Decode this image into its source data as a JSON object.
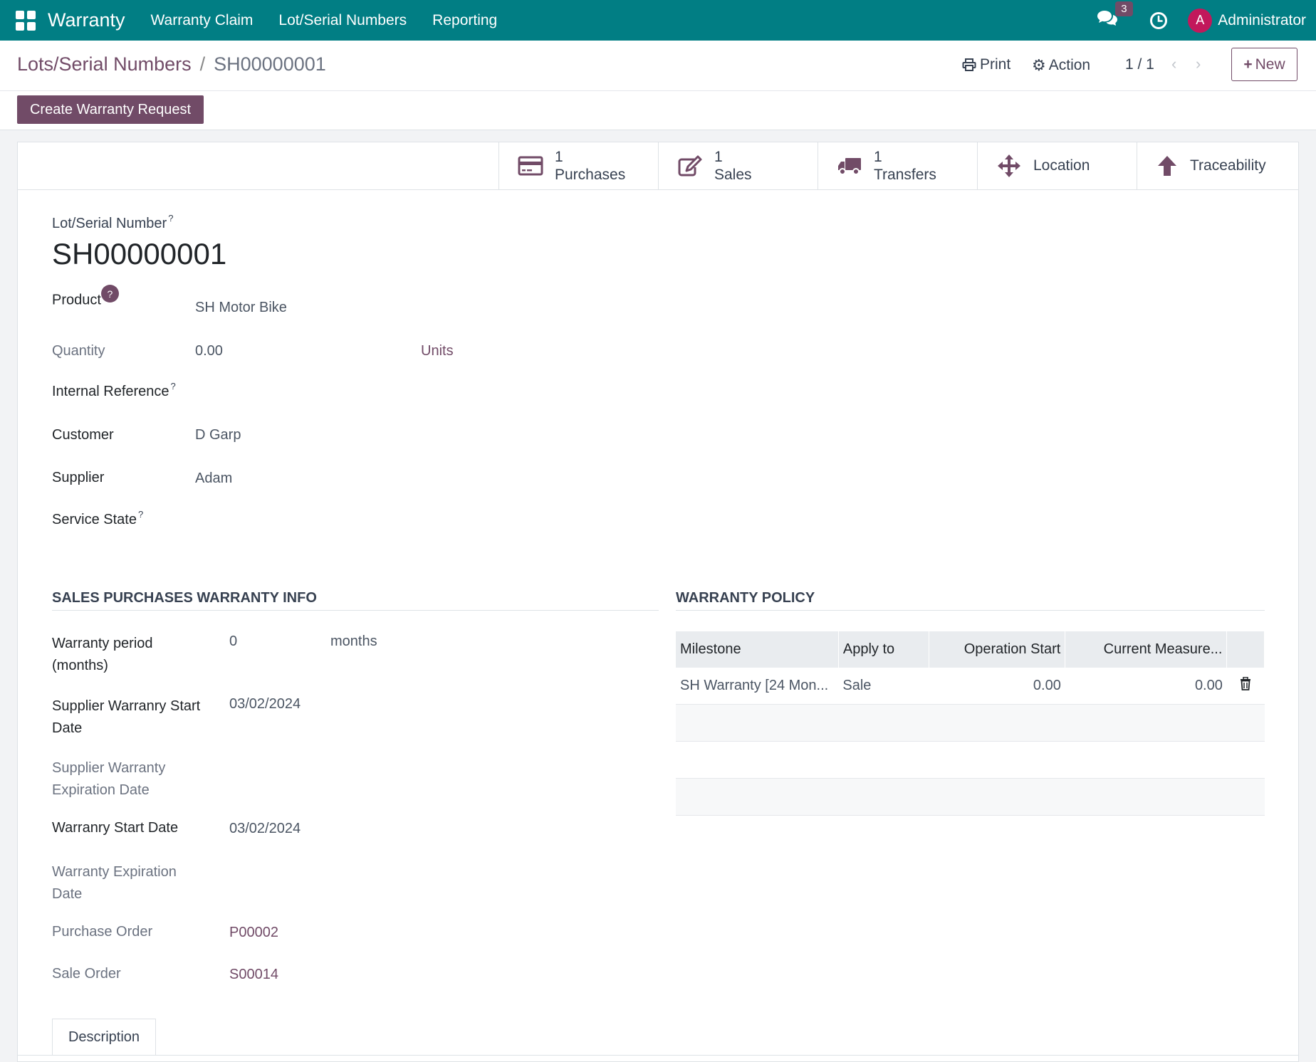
{
  "navbar": {
    "app_name": "Warranty",
    "menus": [
      "Warranty Claim",
      "Lot/Serial Numbers",
      "Reporting"
    ],
    "message_count": "3",
    "avatar_letter": "A",
    "user_name": "Administrator",
    "color": "#017e84"
  },
  "control": {
    "breadcrumb_parent": "Lots/Serial Numbers",
    "breadcrumb_sep": "/",
    "breadcrumb_current": "SH00000001",
    "print_label": "Print",
    "action_label": "Action",
    "pager": "1 / 1",
    "new_label": "New",
    "primary_button": "Create Warranty Request",
    "accent": "#714b67"
  },
  "smart_buttons": [
    {
      "count": "1",
      "label": "Purchases",
      "icon": "credit-card-icon"
    },
    {
      "count": "1",
      "label": "Sales",
      "icon": "edit-icon"
    },
    {
      "count": "1",
      "label": "Transfers",
      "icon": "truck-icon"
    },
    {
      "count": "",
      "label": "Location",
      "icon": "arrows-move-icon"
    },
    {
      "count": "",
      "label": "Traceability",
      "icon": "arrow-up-icon"
    }
  ],
  "form": {
    "lot_label": "Lot/Serial Number",
    "lot_value": "SH00000001",
    "help_mark": "?",
    "product_label": "Product",
    "product_value": "SH Motor Bike",
    "quantity_label": "Quantity",
    "quantity_value": "0.00",
    "quantity_uom": "Units",
    "internal_ref_label": "Internal Reference",
    "customer_label": "Customer",
    "customer_value": "D Garp",
    "supplier_label": "Supplier",
    "supplier_value": "Adam",
    "service_state_label": "Service State"
  },
  "sales_section": {
    "title": "SALES PURCHASES WARRANTY INFO",
    "warranty_period_label_1": "Warranty period",
    "warranty_period_label_2": "(months)",
    "warranty_period_value": "0",
    "warranty_period_unit": "months",
    "supplier_start_label_1": "Supplier Warranry Start",
    "supplier_start_label_2": "Date",
    "supplier_start_value": "03/02/2024",
    "supplier_exp_label_1": "Supplier Warranty",
    "supplier_exp_label_2": "Expiration Date",
    "warranty_start_label": "Warranry Start Date",
    "warranty_start_value": "03/02/2024",
    "warranty_exp_label_1": "Warranty Expiration",
    "warranty_exp_label_2": "Date",
    "purchase_order_label": "Purchase Order",
    "purchase_order_value": "P00002",
    "sale_order_label": "Sale Order",
    "sale_order_value": "S00014"
  },
  "policy": {
    "title": "WARRANTY POLICY",
    "columns": [
      "Milestone",
      "Apply to",
      "Operation Start",
      "Current Measure..."
    ],
    "rows": [
      {
        "milestone": "SH Warranty [24 Mon...",
        "apply_to": "Sale",
        "operation_start": "0.00",
        "current_measure": "0.00"
      }
    ]
  },
  "tabs": {
    "description": "Description"
  }
}
